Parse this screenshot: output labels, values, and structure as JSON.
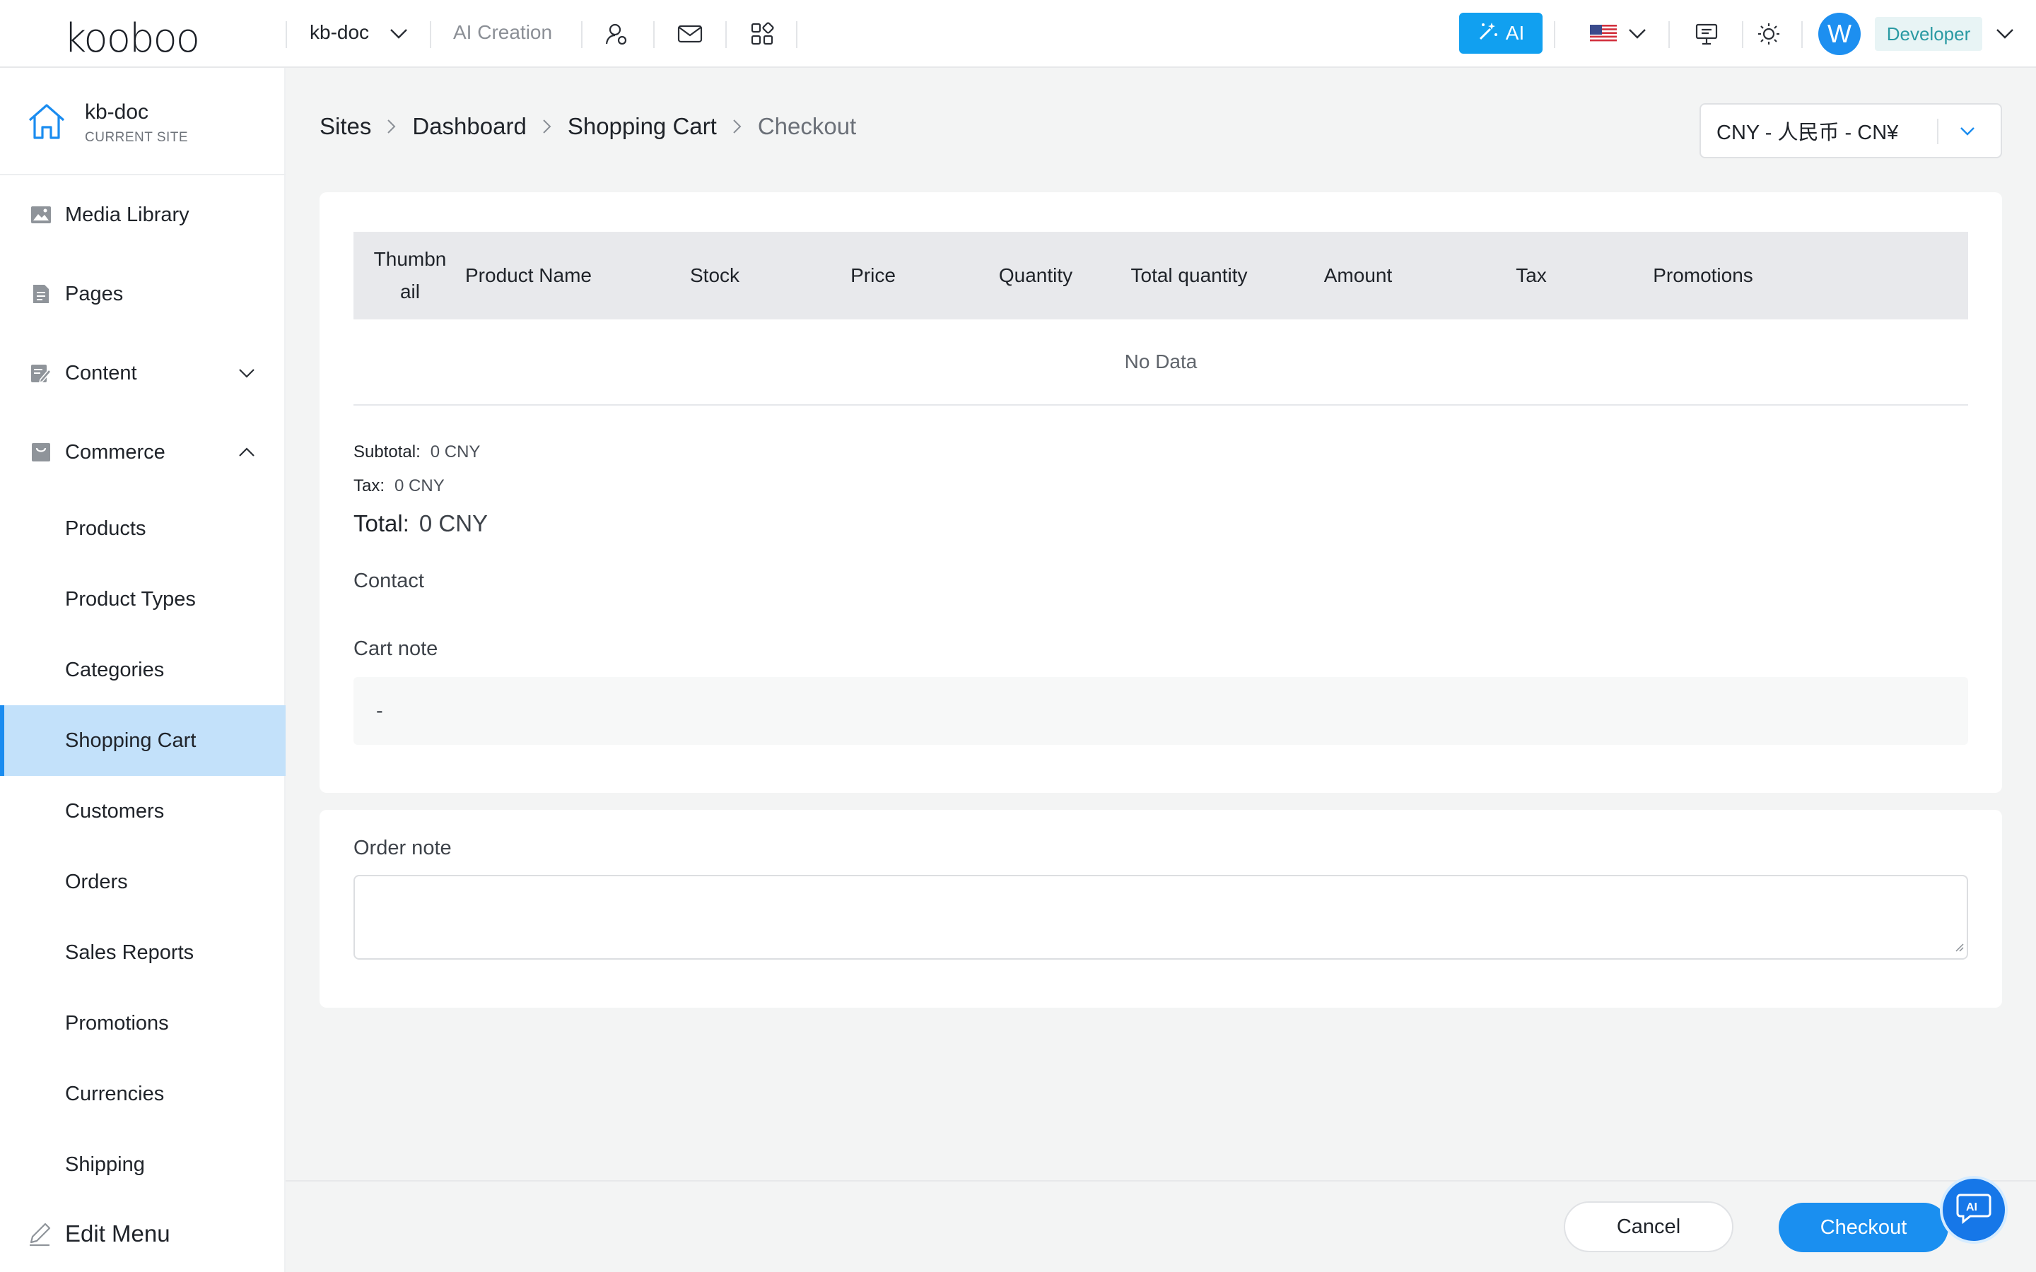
{
  "app": {
    "logo": "kooboo",
    "site_switcher": "kb-doc",
    "ai_creation": "AI Creation",
    "ai_button": "AI",
    "avatar_initial": "W",
    "role": "Developer"
  },
  "sidebar": {
    "site_name": "kb-doc",
    "site_sub": "CURRENT SITE",
    "items": [
      {
        "label": "Media Library",
        "icon": "image-icon"
      },
      {
        "label": "Pages",
        "icon": "page-icon"
      },
      {
        "label": "Content",
        "icon": "content-edit-icon"
      },
      {
        "label": "Commerce",
        "icon": "shopping-bag-icon"
      }
    ],
    "commerce_items": [
      {
        "label": "Products"
      },
      {
        "label": "Product Types"
      },
      {
        "label": "Categories"
      },
      {
        "label": "Shopping Cart"
      },
      {
        "label": "Customers"
      },
      {
        "label": "Orders"
      },
      {
        "label": "Sales Reports"
      },
      {
        "label": "Promotions"
      },
      {
        "label": "Currencies"
      },
      {
        "label": "Shipping"
      }
    ],
    "edit_menu": "Edit Menu"
  },
  "breadcrumb": [
    "Sites",
    "Dashboard",
    "Shopping Cart",
    "Checkout"
  ],
  "currency": {
    "selected": "CNY - 人民币 - CN¥"
  },
  "table": {
    "columns": [
      "Thumbn\nail",
      "Product Name",
      "Stock",
      "Price",
      "Quantity",
      "Total quantity",
      "Amount",
      "Tax",
      "Promotions"
    ],
    "empty_text": "No Data"
  },
  "summary": {
    "subtotal_label": "Subtotal:",
    "subtotal_value": "0 CNY",
    "tax_label": "Tax:",
    "tax_value": "0 CNY",
    "total_label": "Total:",
    "total_value": "0 CNY"
  },
  "contact_label": "Contact",
  "cart_note": {
    "label": "Cart note",
    "value": "-"
  },
  "order_note": {
    "label": "Order note",
    "value": ""
  },
  "actions": {
    "cancel": "Cancel",
    "checkout": "Checkout"
  },
  "colors": {
    "accent": "#1a8ff0",
    "active_bg": "#c3e1fa",
    "ai": "#11a0f0"
  }
}
